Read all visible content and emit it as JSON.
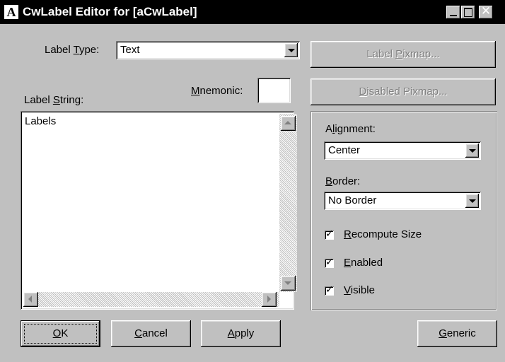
{
  "window": {
    "title": "CwLabel Editor for [aCwLabel]",
    "icon_letter": "A"
  },
  "form": {
    "label_type": {
      "label_pre": "Label ",
      "label_u": "T",
      "label_post": "ype:",
      "value": "Text"
    },
    "label_string": {
      "label_pre": "Label ",
      "label_u": "S",
      "label_post": "tring:"
    },
    "mnemonic": {
      "label_pre": "",
      "label_u": "M",
      "label_post": "nemonic:",
      "value": ""
    },
    "text_content": "Labels"
  },
  "side_buttons": {
    "label_pixmap": {
      "pre": "Label ",
      "u": "P",
      "post": "ixmap..."
    },
    "disabled_pixmap": {
      "pre": "",
      "u": "D",
      "post": "isabled Pixmap..."
    }
  },
  "group": {
    "alignment": {
      "label_pre": "A",
      "label_u": "l",
      "label_post": "ignment:",
      "value": "Center"
    },
    "border": {
      "label_pre": "",
      "label_u": "B",
      "label_post": "order:",
      "value": "No Border"
    },
    "checkboxes": [
      {
        "pre": "",
        "u": "R",
        "post": "ecompute Size",
        "checked": true
      },
      {
        "pre": "",
        "u": "E",
        "post": "nabled",
        "checked": true
      },
      {
        "pre": "",
        "u": "V",
        "post": "isible",
        "checked": true
      }
    ]
  },
  "bottom_buttons": {
    "ok": {
      "pre": "",
      "u": "O",
      "post": "K"
    },
    "cancel": {
      "pre": "",
      "u": "C",
      "post": "ancel"
    },
    "apply": {
      "pre": "",
      "u": "A",
      "post": "pply"
    },
    "generic": {
      "pre": "",
      "u": "G",
      "post": "eneric"
    }
  }
}
